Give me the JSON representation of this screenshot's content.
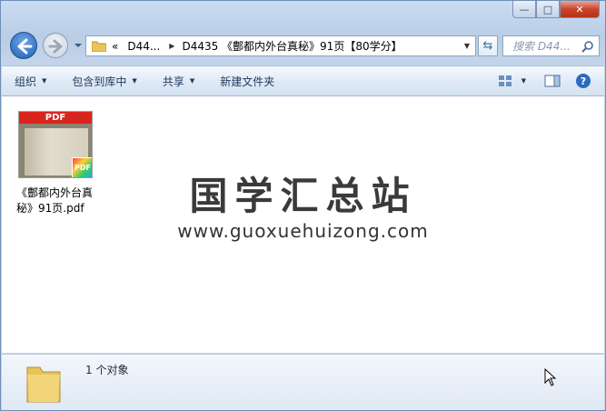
{
  "window": {
    "controls": {
      "minimize": "—",
      "maximize": "□",
      "close": "✕"
    }
  },
  "nav": {
    "back_icon": "back-arrow-icon",
    "forward_icon": "forward-arrow-icon",
    "address": {
      "overflow": "«",
      "segments": [
        "D44...",
        "D4435 《鄷都内外台真秘》91页【80学分】"
      ]
    },
    "search_placeholder": "搜索 D44..."
  },
  "toolbar": {
    "organize": "组织",
    "include_library": "包含到库中",
    "share": "共享",
    "new_folder": "新建文件夹"
  },
  "content": {
    "file": {
      "thumb_label": "PDF",
      "badge": "PDF",
      "name": "《鄷都内外台真秘》91页.pdf"
    },
    "watermark_title": "国学汇总站",
    "watermark_url": "www.guoxuehuizong.com"
  },
  "details": {
    "count": "1 个对象"
  },
  "colors": {
    "accent": "#1d5fb8",
    "pdf_red": "#d9261c"
  }
}
